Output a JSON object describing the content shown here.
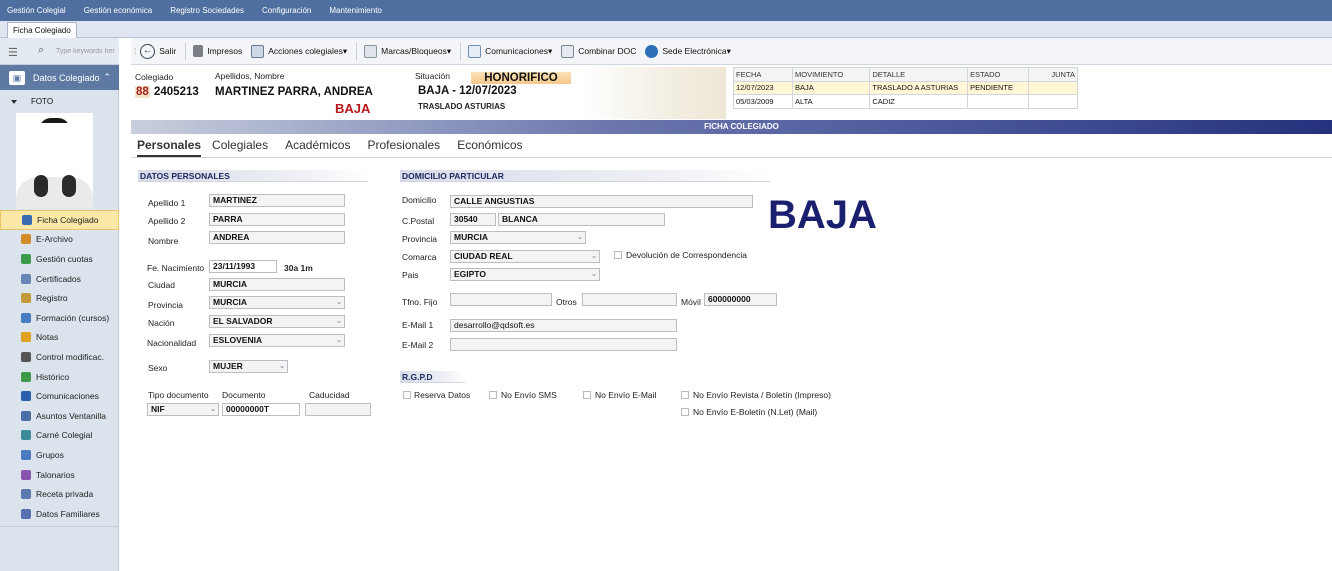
{
  "menubar": [
    "Gestión Colegial",
    "Gestión económica",
    "Registro Sociedades",
    "Configuración",
    "Mantenimiento"
  ],
  "tabstrip": {
    "active_tab": "Ficha Colegiado"
  },
  "sidebar": {
    "search_placeholder": "Type keywords her",
    "section_title": "Datos Colegiado",
    "foto_label": "FOTO",
    "items": [
      {
        "label": "Ficha Colegiado",
        "icon": "id-card-icon",
        "color": "#3a6bb0",
        "active": true
      },
      {
        "label": "E-Archivo",
        "icon": "archive-icon",
        "color": "#d38b2a"
      },
      {
        "label": "Gestión cuotas",
        "icon": "fees-icon",
        "color": "#3c9a4a"
      },
      {
        "label": "Certificados",
        "icon": "certificate-icon",
        "color": "#6a86b8"
      },
      {
        "label": "Registro",
        "icon": "register-icon",
        "color": "#c59a3a"
      },
      {
        "label": "Formación (cursos)",
        "icon": "training-icon",
        "color": "#4a7ac0"
      },
      {
        "label": "Notas",
        "icon": "notes-icon",
        "color": "#e0a020"
      },
      {
        "label": "Control modificac.",
        "icon": "eye-icon",
        "color": "#555555"
      },
      {
        "label": "Histórico",
        "icon": "history-icon",
        "color": "#3c9a4a"
      },
      {
        "label": "Comunicaciones",
        "icon": "communications-icon",
        "color": "#2b5fae"
      },
      {
        "label": "Asuntos Ventanilla",
        "icon": "window-icon",
        "color": "#4a6fa8"
      },
      {
        "label": "Carné Colegial",
        "icon": "card-icon",
        "color": "#3c8a9a"
      },
      {
        "label": "Grupos",
        "icon": "groups-icon",
        "color": "#4a7ac0"
      },
      {
        "label": "Talonarios",
        "icon": "checkbook-icon",
        "color": "#8a55b0"
      },
      {
        "label": "Receta privada",
        "icon": "prescription-icon",
        "color": "#5a7ab0"
      },
      {
        "label": "Datos Familiares",
        "icon": "family-icon",
        "color": "#5a6fb0"
      }
    ]
  },
  "toolbar": {
    "salir": "Salir",
    "impresos": "Impresos",
    "acciones": "Acciones colegiales",
    "marcas": "Marcas/Bloqueos",
    "comunicaciones": "Comunicaciones",
    "combinar": "Combinar DOC",
    "sede": "Sede Electrónica"
  },
  "info": {
    "colegiado_label": "Colegiado",
    "colegiado_prefix": "88",
    "colegiado_num": "2405213",
    "nombre_label": "Apellidos, Nombre",
    "nombre": "MARTINEZ PARRA, ANDREA",
    "baja_small": "BAJA",
    "situacion_label": "Situación",
    "honorifico": "HONORIFICO",
    "situacion": "BAJA - 12/07/2023",
    "traslado": "TRASLADO ASTURIAS"
  },
  "movimientos": {
    "headers": [
      "FECHA",
      "MOVIMIENTO",
      "DETALLE",
      "ESTADO",
      "JUNTA"
    ],
    "rows": [
      [
        "12/07/2023",
        "BAJA",
        "TRASLADO A ASTURIAS",
        "PENDIENTE",
        ""
      ],
      [
        "05/03/2009",
        "ALTA",
        "CADIZ",
        "",
        ""
      ]
    ]
  },
  "header_bar": "FICHA COLEGIADO",
  "subtabs": [
    "Personales",
    "Colegiales",
    "Académicos",
    "Profesionales",
    "Económicos"
  ],
  "personales": {
    "section": "DATOS PERSONALES",
    "apellido1_label": "Apellido 1",
    "apellido1": "MARTINEZ",
    "apellido2_label": "Apellido 2",
    "apellido2": "PARRA",
    "nombre_label": "Nombre",
    "nombre": "ANDREA",
    "nacimiento_label": "Fe. Nacimiento",
    "nacimiento": "23/11/1993",
    "edad": "30a 1m",
    "ciudad_label": "Ciudad",
    "ciudad": "MURCIA",
    "provincia_label": "Provincia",
    "provincia": "MURCIA",
    "nacion_label": "Nación",
    "nacion": "EL SALVADOR",
    "nacionalidad_label": "Nacionalidad",
    "nacionalidad": "ESLOVENIA",
    "sexo_label": "Sexo",
    "sexo": "MUJER",
    "tipodoc_label": "Tipo documento",
    "tipodoc": "NIF",
    "documento_label": "Documento",
    "documento": "00000000T",
    "caducidad_label": "Caducidad",
    "caducidad": ""
  },
  "domicilio": {
    "section": "DOMICILIO PARTICULAR",
    "domicilio_label": "Domicilio",
    "domicilio": "CALLE ANGUSTIAS",
    "cp_label": "C.Postal",
    "cp": "30540",
    "localidad": "BLANCA",
    "provincia_label": "Provincia",
    "provincia": "MURCIA",
    "comarca_label": "Comarca",
    "comarca": "CIUDAD REAL",
    "devolucion": "Devolución de Correspondencia",
    "pais_label": "Pais",
    "pais": "EGIPTO",
    "tfno_label": "Tfno. Fijo",
    "tfno": "",
    "otros_label": "Otros",
    "otros": "",
    "movil_label": "Móvil",
    "movil": "600000000",
    "email1_label": "E-Mail 1",
    "email1": "desarrollo@qdsoft.es",
    "email2_label": "E-Mail 2",
    "email2": ""
  },
  "baja_stamp": "BAJA",
  "rgpd": {
    "section": "R.G.P.D",
    "reserva": "Reserva Datos",
    "no_sms": "No Envío SMS",
    "no_email": "No Envío E-Mail",
    "no_revista": "No Envío Revista / Boletín (Impreso)",
    "no_eboletin": "No Envío E-Boletín (N.Let) (Mail)"
  }
}
